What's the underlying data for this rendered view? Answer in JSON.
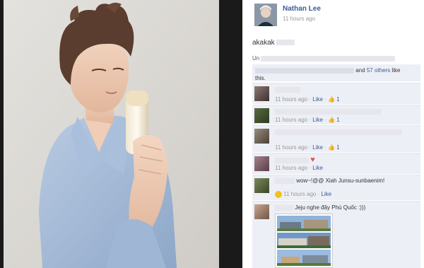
{
  "author": {
    "name": "Nathan Lee",
    "time": "11 hours ago"
  },
  "post": {
    "caption": "akakak"
  },
  "actions": {
    "unlike_prefix": "Un"
  },
  "likes": {
    "suffix": "and",
    "others_link": "57 others",
    "like_text": "like",
    "this_text": "this."
  },
  "comments": [
    {
      "time": "11 hours ago",
      "like": "Like",
      "count": "1"
    },
    {
      "time": "11 hours ago",
      "like": "Like",
      "count": "1"
    },
    {
      "time": "11 hours ago",
      "like": "Like",
      "count": "1"
    },
    {
      "time": "11 hours ago",
      "like": "Like"
    },
    {
      "text": "wow~!@@ Xiah Junsu-sunbaenim!",
      "time": "11 hours ago",
      "like": "Like"
    },
    {
      "text": "Jeju nghe đây Phú Quốc :)))"
    }
  ],
  "colors": {
    "link": "#3b5998",
    "comment_bg": "#eceff5",
    "photo_bg": "#d9d6d1"
  },
  "icons": [
    "thumbs-up-icon",
    "heart-icon",
    "smile-icon"
  ]
}
